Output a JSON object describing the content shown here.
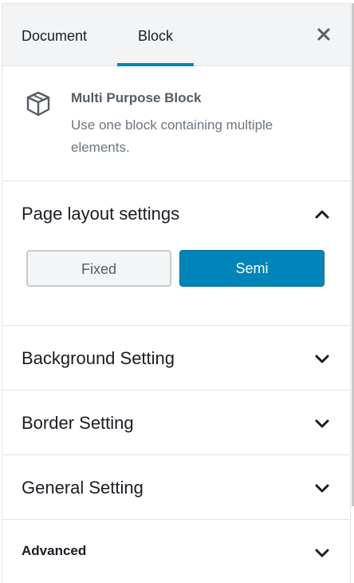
{
  "tabs": {
    "document_label": "Document",
    "block_label": "Block",
    "close_icon": "close-icon"
  },
  "block_card": {
    "icon": "cube-icon",
    "title": "Multi Purpose Block",
    "description": "Use one block containing multiple elements."
  },
  "panels": {
    "page_layout": {
      "title": "Page layout settings",
      "expanded": true,
      "options": [
        "Fixed",
        "Semi"
      ],
      "selected": "Semi"
    },
    "background": {
      "title": "Background Setting",
      "expanded": false
    },
    "border": {
      "title": "Border Setting",
      "expanded": false
    },
    "general": {
      "title": "General Setting",
      "expanded": false
    },
    "advanced": {
      "title": "Advanced",
      "expanded": false
    }
  },
  "colors": {
    "accent": "#0085ba",
    "tab_bar_bg": "#f3f4f5",
    "divider": "#e2e4e7"
  }
}
